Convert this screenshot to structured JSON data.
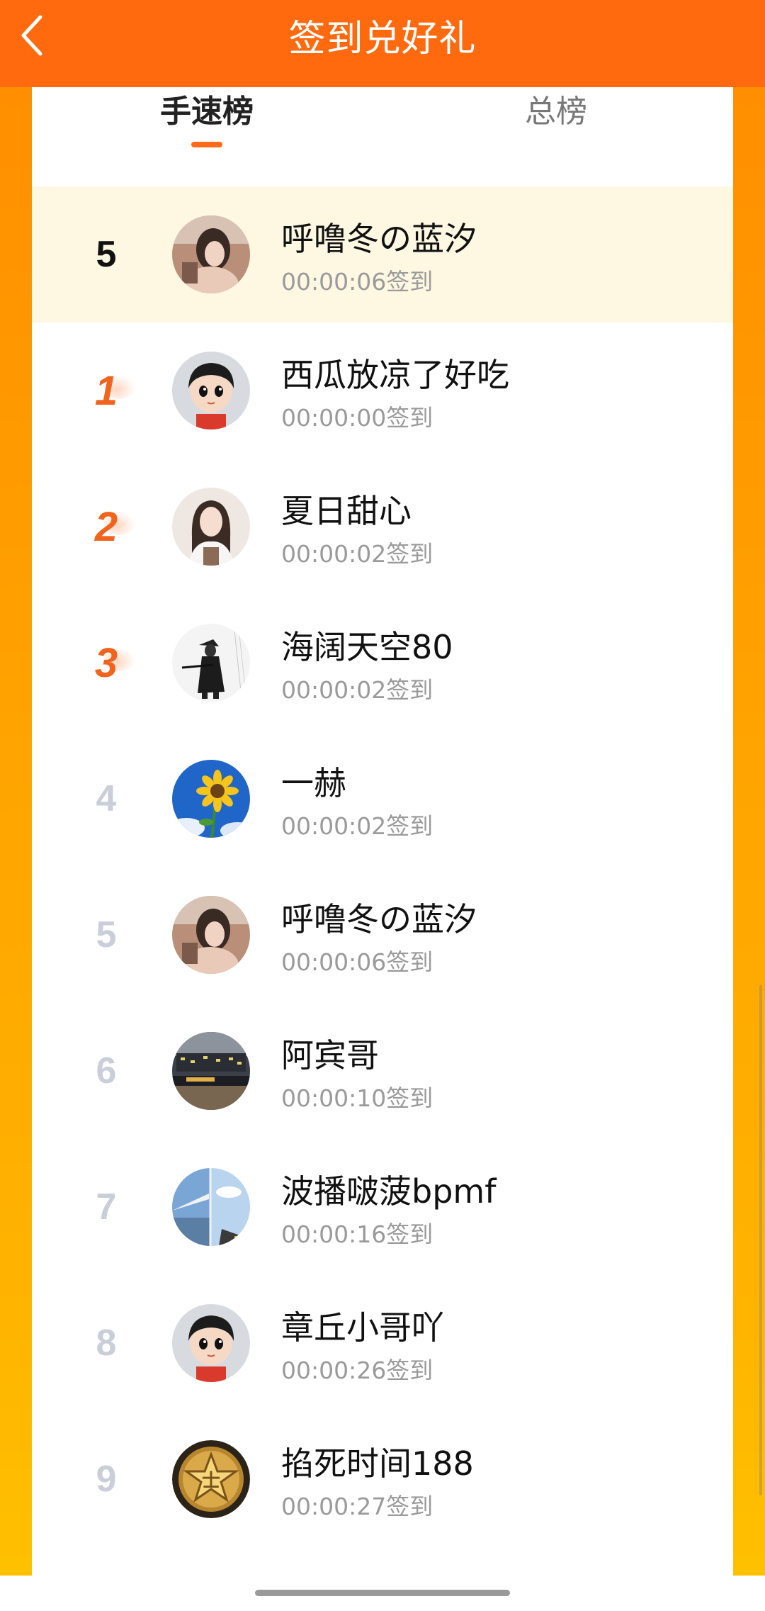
{
  "header": {
    "title": "签到兑好礼",
    "back_icon": "chevron-left-icon"
  },
  "tabs": [
    {
      "label": "手速榜",
      "active": true
    },
    {
      "label": "总榜",
      "active": false
    }
  ],
  "my_rank": {
    "rank": "5",
    "name": "呼噜冬の蓝汐",
    "time": "00:00:06签到",
    "avatar": "girl-photo-avatar"
  },
  "ranking": [
    {
      "rank": "1",
      "name": "西瓜放凉了好吃",
      "time": "00:00:00签到",
      "avatar": "cartoon-boy-avatar"
    },
    {
      "rank": "2",
      "name": "夏日甜心",
      "time": "00:00:02签到",
      "avatar": "girl-portrait-avatar"
    },
    {
      "rank": "3",
      "name": "海阔天空80",
      "time": "00:00:02签到",
      "avatar": "swordsman-ink-avatar"
    },
    {
      "rank": "4",
      "name": "一赫",
      "time": "00:00:02签到",
      "avatar": "sunflower-avatar"
    },
    {
      "rank": "5",
      "name": "呼噜冬の蓝汐",
      "time": "00:00:06签到",
      "avatar": "girl-photo-avatar"
    },
    {
      "rank": "6",
      "name": "阿宾哥",
      "time": "00:00:10签到",
      "avatar": "night-city-avatar"
    },
    {
      "rank": "7",
      "name": "波播啵菠bpmf",
      "time": "00:00:16签到",
      "avatar": "airplane-sky-avatar"
    },
    {
      "rank": "8",
      "name": "章丘小哥吖",
      "time": "00:00:26签到",
      "avatar": "cartoon-boy-avatar"
    },
    {
      "rank": "9",
      "name": "掐死时间188",
      "time": "00:00:27签到",
      "avatar": "gold-star-badge-avatar"
    }
  ],
  "colors": {
    "header": "#ff6a0f",
    "accent": "#f0641e",
    "highlight_row": "#fef7e2",
    "rank_gray": "#c9ced8",
    "time_gray": "#9a9a9a"
  }
}
